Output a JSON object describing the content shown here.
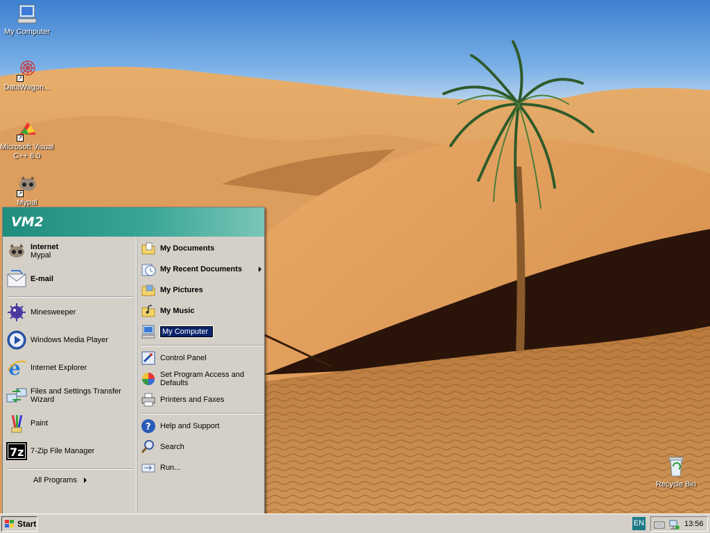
{
  "desktop": {
    "icons": [
      {
        "label": "My Computer",
        "icon": "my-computer-icon"
      },
      {
        "label": "DataWagon...",
        "icon": "datawagon-icon"
      },
      {
        "label": "Microsoft Visual C++ 6.0",
        "icon": "visual-cpp-icon"
      },
      {
        "label": "Mypal",
        "icon": "mypal-icon"
      },
      {
        "label": "Recycle Bin",
        "icon": "recycle-bin-icon"
      }
    ]
  },
  "start_menu": {
    "user": "VM2",
    "pinned": [
      {
        "title": "Internet",
        "subtitle": "Mypal",
        "icon": "mypal-icon"
      },
      {
        "title": "E-mail",
        "subtitle": "",
        "icon": "email-icon"
      }
    ],
    "recent": [
      {
        "label": "Minesweeper",
        "icon": "minesweeper-icon"
      },
      {
        "label": "Windows Media Player",
        "icon": "media-player-icon"
      },
      {
        "label": "Internet Explorer",
        "icon": "internet-explorer-icon"
      },
      {
        "label": "Files and Settings Transfer Wizard",
        "icon": "transfer-wizard-icon"
      },
      {
        "label": "Paint",
        "icon": "paint-icon"
      },
      {
        "label": "7-Zip File Manager",
        "icon": "7zip-icon"
      }
    ],
    "all_programs": "All Programs",
    "places": [
      {
        "label": "My Documents",
        "icon": "documents-folder-icon"
      },
      {
        "label": "My Recent Documents",
        "icon": "recent-documents-icon"
      },
      {
        "label": "My Pictures",
        "icon": "pictures-folder-icon"
      },
      {
        "label": "My Music",
        "icon": "music-folder-icon"
      },
      {
        "label": "My Computer",
        "icon": "my-computer-icon"
      }
    ],
    "settings": [
      {
        "label": "Control Panel",
        "icon": "control-panel-icon"
      },
      {
        "label": "Set Program Access and Defaults",
        "icon": "program-access-icon"
      },
      {
        "label": "Printers and Faxes",
        "icon": "printer-icon"
      }
    ],
    "tools": [
      {
        "label": "Help and Support",
        "icon": "help-icon"
      },
      {
        "label": "Search",
        "icon": "search-icon"
      },
      {
        "label": "Run...",
        "icon": "run-icon"
      }
    ]
  },
  "taskbar": {
    "start_label": "Start",
    "language": "EN",
    "clock": "13:56"
  },
  "colors": {
    "sky": "#4a90d9",
    "sand": "#d9924a",
    "menu_face": "#d4d0c8",
    "header_teal": "#2a9a8a",
    "selection": "#0a246a"
  }
}
